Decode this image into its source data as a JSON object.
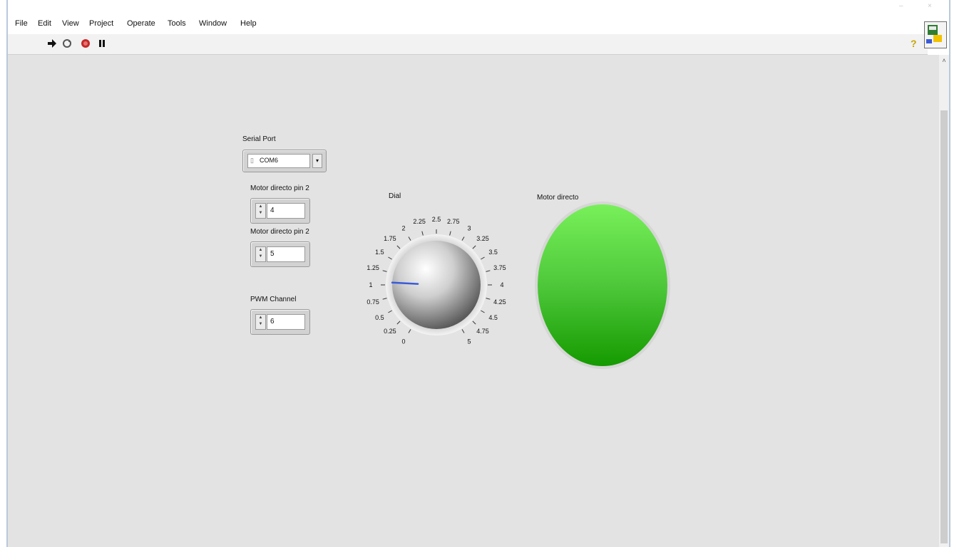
{
  "menubar": {
    "items": [
      "File",
      "Edit",
      "View",
      "Project",
      "Operate",
      "Tools",
      "Window",
      "Help"
    ]
  },
  "toolbar": {
    "icons": [
      "run-arrow-icon",
      "run-continuously-icon",
      "abort-stop-icon",
      "pause-icon",
      "help-question-icon"
    ]
  },
  "panel": {
    "serial_port": {
      "label": "Serial Port",
      "value": "COM6"
    },
    "pin_a": {
      "label": "Motor directo pin 2",
      "value": "4"
    },
    "pin_b": {
      "label": "Motor directo pin 2",
      "value": "5"
    },
    "pwm": {
      "label": "PWM Channel",
      "value": "6"
    },
    "dial": {
      "label": "Dial",
      "min": 0,
      "max": 5,
      "value": 1.05,
      "ticks": [
        "0",
        "0.25",
        "0.5",
        "0.75",
        "1",
        "1.25",
        "1.5",
        "1.75",
        "2",
        "2.25",
        "2.5",
        "2.75",
        "3",
        "3.25",
        "3.5",
        "3.75",
        "4",
        "4.25",
        "4.5",
        "4.75",
        "5"
      ]
    },
    "led": {
      "label": "Motor directo",
      "state": "on",
      "color": "#3fbf2a"
    }
  },
  "colors": {
    "panel": "#e3e3e3",
    "needle": "#3a5bd9"
  }
}
